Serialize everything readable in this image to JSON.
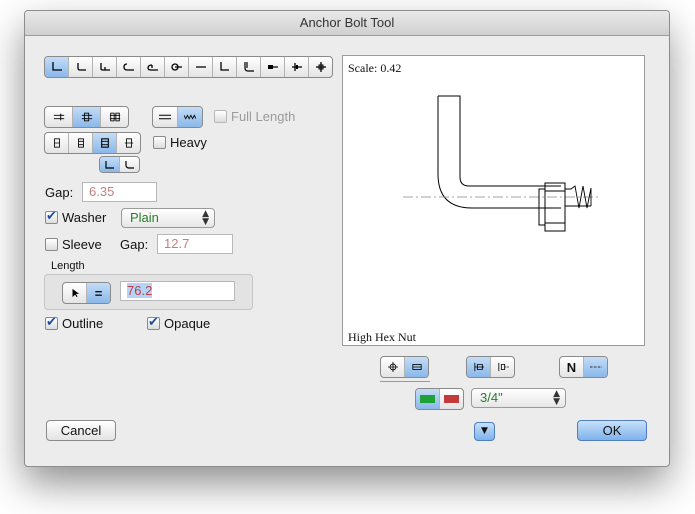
{
  "window": {
    "title": "Anchor Bolt Tool"
  },
  "toolbar": {
    "shape_buttons": [
      "l-hook",
      "l-hook-short",
      "j-hook",
      "j-hook-open",
      "j-hook-round",
      "loop",
      "straight",
      "l-bend",
      "l-bend-long",
      "headed",
      "double-end",
      "plate"
    ],
    "selected_index": 0
  },
  "rows": {
    "end_style_count": 3,
    "thread_buttons": {
      "selected": "threaded"
    },
    "full_length": {
      "label": "Full Length",
      "checked": false
    },
    "nut_buttons_count": 4,
    "heavy": {
      "label": "Heavy",
      "checked": false
    },
    "bend_toggle_count": 2
  },
  "gap": {
    "label": "Gap:",
    "value": "6.35"
  },
  "washer": {
    "label": "Washer",
    "checked": true,
    "type": "Plain"
  },
  "sleeve": {
    "label": "Sleeve",
    "checked": false,
    "gap_label": "Gap:",
    "gap_value": "12.7"
  },
  "length": {
    "label": "Length",
    "value": "76.2"
  },
  "outline": {
    "label": "Outline",
    "checked": true
  },
  "opaque": {
    "label": "Opaque",
    "checked": true
  },
  "preview": {
    "scale": "Scale: 0.42",
    "caption": "High Hex Nut"
  },
  "bottom_controls": {
    "n_label": "N",
    "size": "3/4\"",
    "color_on": "#1fa13a",
    "color_off": "#c23a3a"
  },
  "buttons": {
    "cancel": "Cancel",
    "ok": "OK"
  }
}
